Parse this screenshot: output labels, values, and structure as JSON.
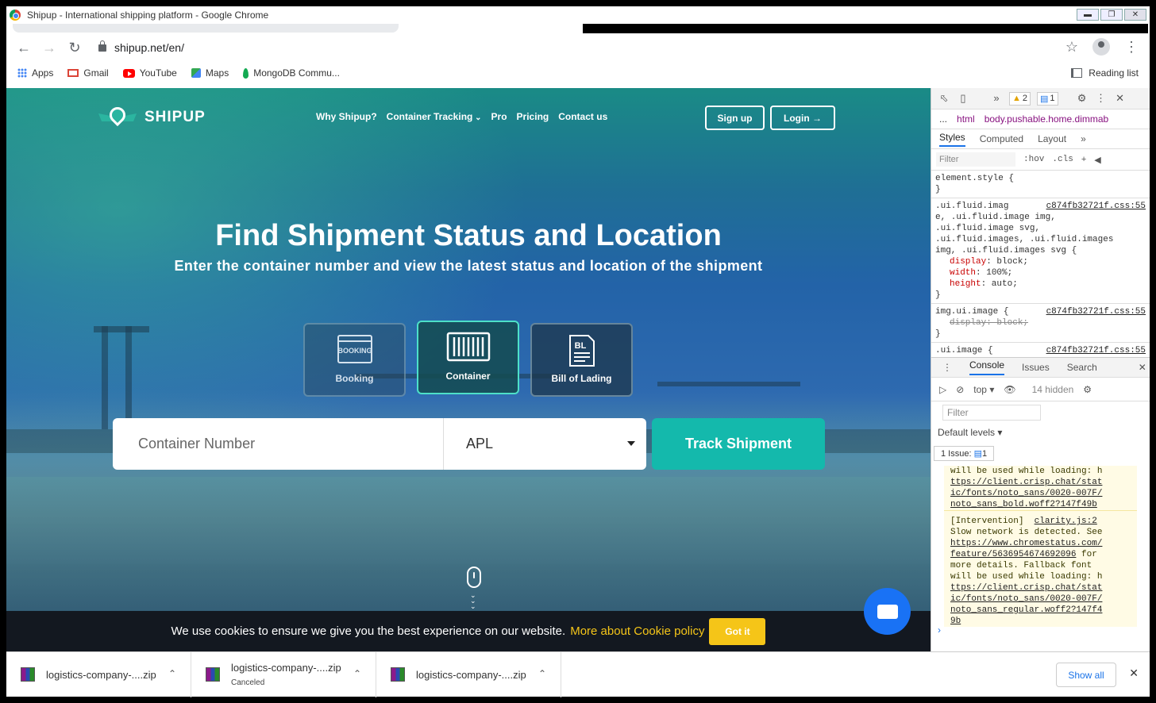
{
  "window": {
    "title": "Shipup - International shipping platform - Google Chrome"
  },
  "address": {
    "url": "shipup.net/en/"
  },
  "bookmarks": [
    {
      "label": "Apps"
    },
    {
      "label": "Gmail"
    },
    {
      "label": "YouTube"
    },
    {
      "label": "Maps"
    },
    {
      "label": "MongoDB Commu..."
    }
  ],
  "reading_list": "Reading list",
  "site": {
    "logo": "SHIPUP",
    "nav": [
      "Why Shipup?",
      "Container Tracking",
      "Pro",
      "Pricing",
      "Contact us"
    ],
    "signup": "Sign up",
    "login": "Login →",
    "hero_title": "Find Shipment Status and Location",
    "hero_sub": "Enter the container number and view the latest status and location of the shipment",
    "cards": [
      {
        "icon_text": "BOOKING",
        "label": "Booking"
      },
      {
        "icon_text": "",
        "label": "Container"
      },
      {
        "icon_text": "BL",
        "label": "Bill of Lading"
      }
    ],
    "search_placeholder": "Container Number",
    "carrier": "APL",
    "track_button": "Track Shipment",
    "cookie_text": "We use cookies to ensure we give you the best experience on our website.",
    "cookie_link": "More about Cookie policy",
    "cookie_button": "Got it"
  },
  "devtools": {
    "warnings": "2",
    "issues": "1",
    "crumb_html": "html",
    "crumb_body": "body.pushable.home.dimmab",
    "tabs": [
      "Styles",
      "Computed",
      "Layout"
    ],
    "filter": "Filter",
    "hov": ":hov",
    "cls": ".cls",
    "rules": {
      "r0": "element.style {",
      "close": "}",
      "r1_sel_a": ".ui.fluid.imag",
      "r1_src": "c874fb32721f.css:55",
      "r1_sel_b": "e, .ui.fluid.image img,",
      "r1_sel_c": ".ui.fluid.image svg,",
      "r1_sel_d": ".ui.fluid.images, .ui.fluid.images",
      "r1_sel_e": "img, .ui.fluid.images svg {",
      "p1n": "display",
      "p1v": ": block;",
      "p2n": "width",
      "p2v": ": 100%;",
      "p3n": "height",
      "p3v": ": auto;",
      "r2_sel": "img.ui.image {",
      "r2_src": "c874fb32721f.css:55",
      "r2_prop": "display: block;",
      "r3_sel": ".ui.image {",
      "r3_src": "c874fb32721f.css:55"
    },
    "console_tabs": [
      "Console",
      "Issues",
      "Search"
    ],
    "context": "top",
    "hidden": "14 hidden",
    "console_filter": "Filter",
    "levels": "Default levels ▾",
    "issue_count": "1 Issue:",
    "issue_num": "1",
    "log": {
      "a1": "will be used while loading: h",
      "a2": "ttps://client.crisp.chat/stat",
      "a3": "ic/fonts/noto_sans/0020-007F/",
      "a4": "noto_sans_bold.woff2?147f49b",
      "b_tag": "[Intervention]",
      "b_src": "clarity.js:2",
      "b1": "Slow network is detected. See",
      "b2": "https://www.chromestatus.com/",
      "b3": "feature/5636954674692096",
      "b3b": " for",
      "b4": "more details. Fallback font",
      "b5": "will be used while loading: h",
      "b6": "ttps://client.crisp.chat/stat",
      "b7": "ic/fonts/noto_sans/0020-007F/",
      "b8": "noto_sans_regular.woff2?147f4",
      "b9": "9b"
    }
  },
  "downloads": [
    {
      "name": "logistics-company-....zip",
      "status": ""
    },
    {
      "name": "logistics-company-....zip",
      "status": "Canceled"
    },
    {
      "name": "logistics-company-....zip",
      "status": ""
    }
  ],
  "show_all": "Show all"
}
